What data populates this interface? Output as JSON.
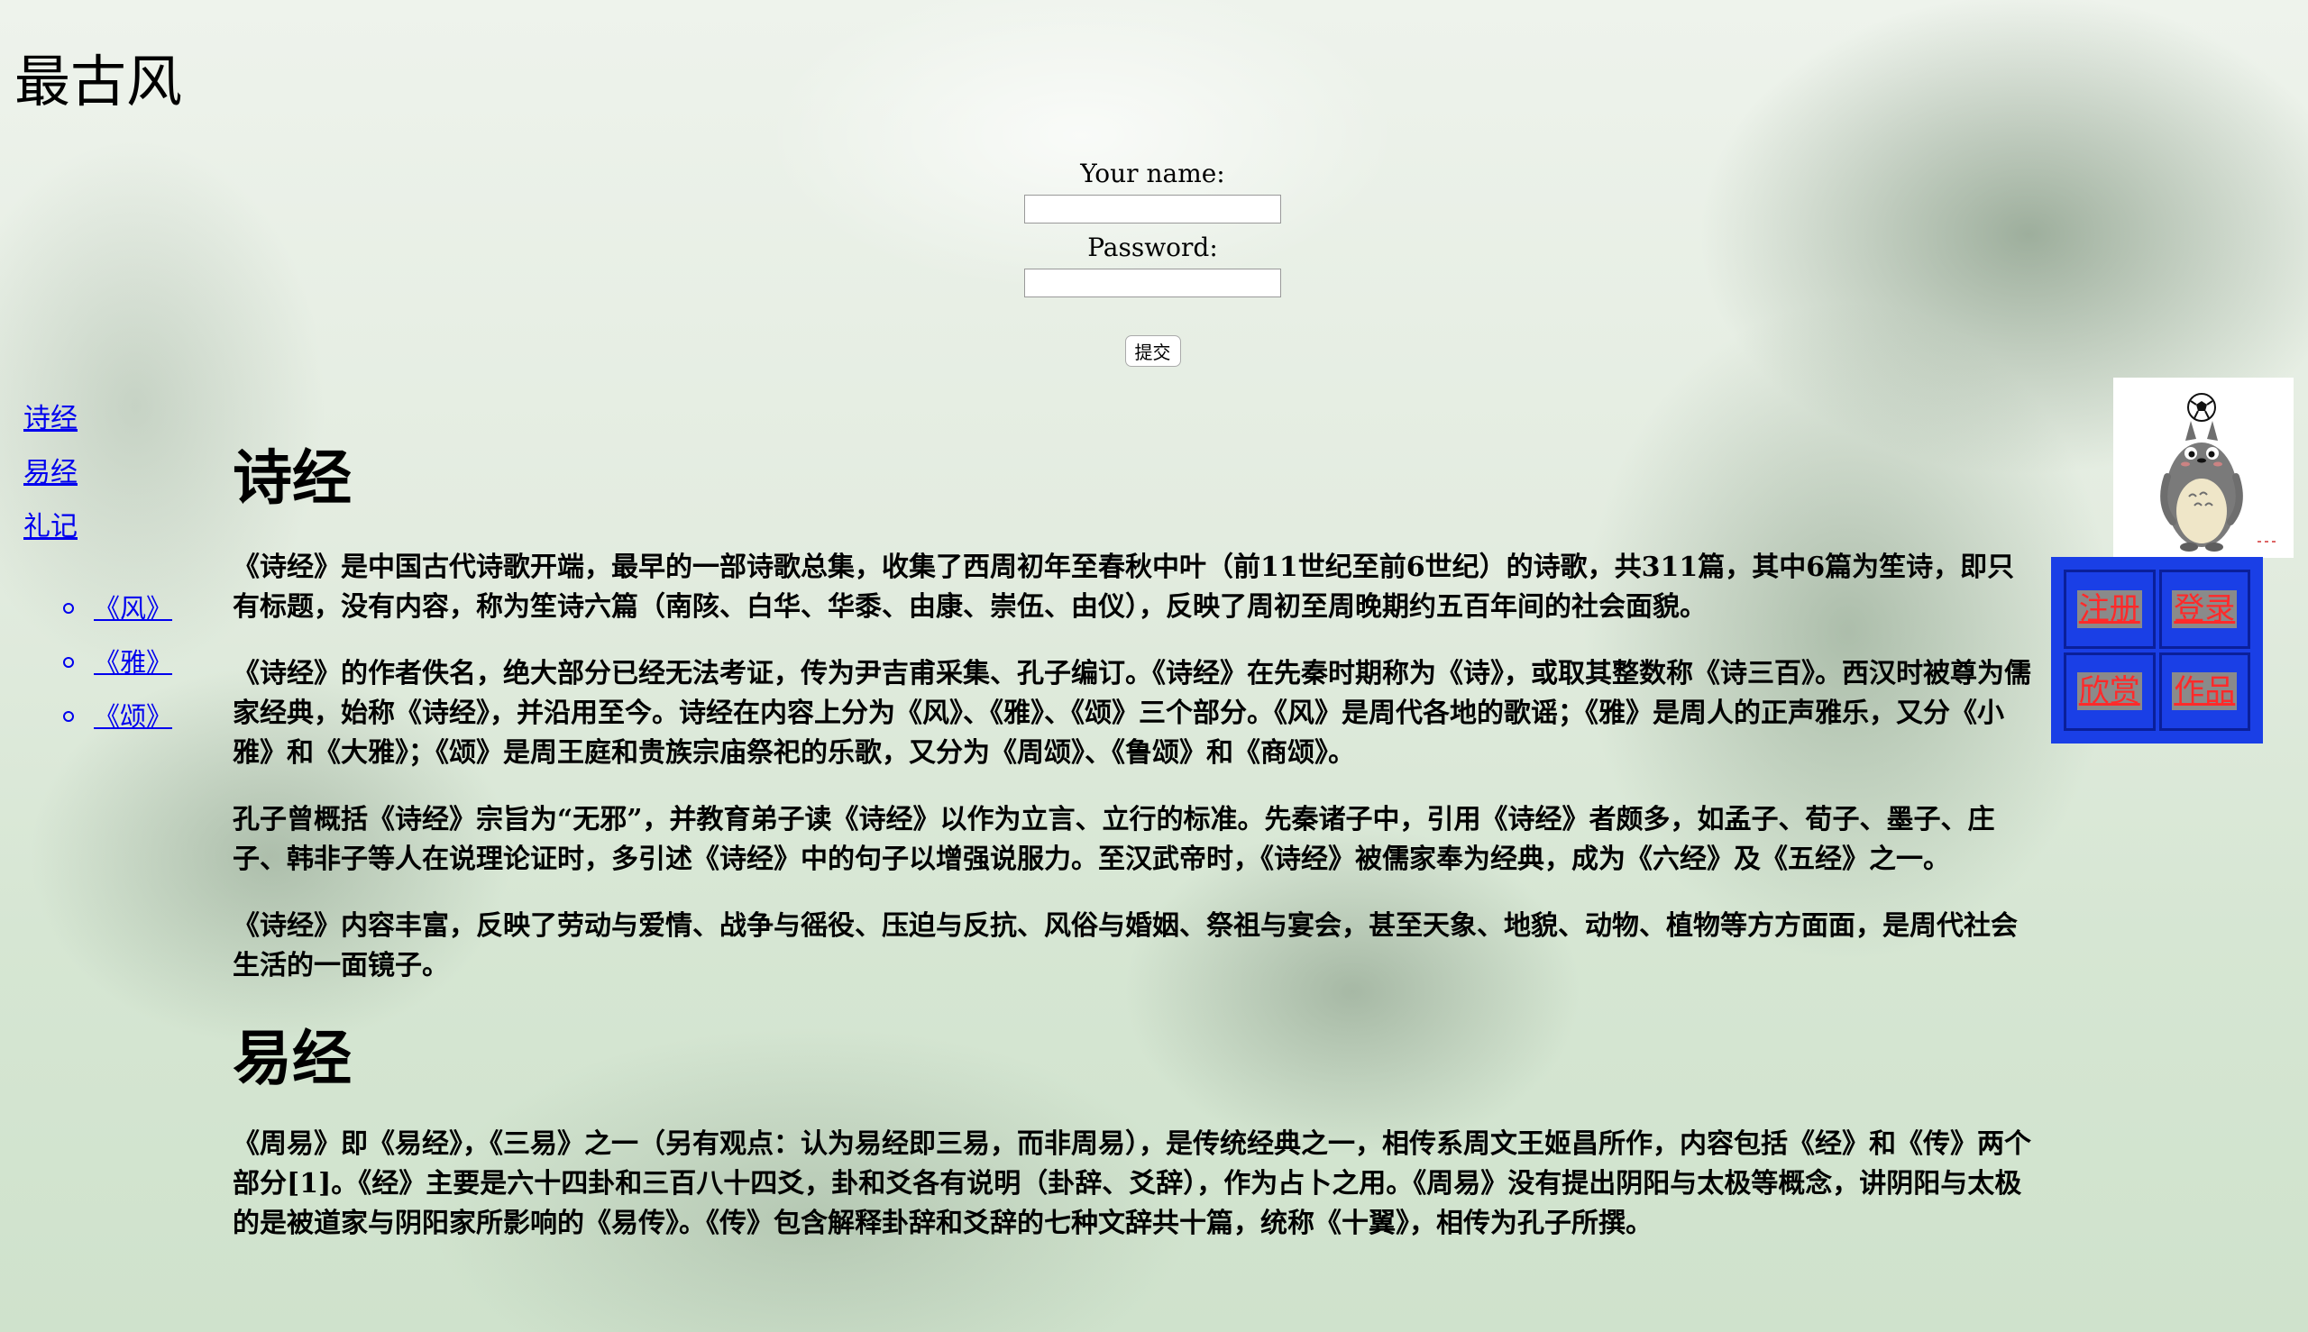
{
  "site": {
    "title": "最古风"
  },
  "login": {
    "name_label": "Your name:",
    "name_value": "",
    "password_label": "Password:",
    "password_value": "",
    "submit_label": "提交"
  },
  "side_nav": {
    "items": [
      {
        "label": "诗经"
      },
      {
        "label": "易经"
      },
      {
        "label": "礼记"
      }
    ],
    "sub_items": [
      {
        "label": "《风》"
      },
      {
        "label": "《雅》"
      },
      {
        "label": "《颂》"
      }
    ]
  },
  "main": {
    "section1": {
      "title": "诗经",
      "paragraphs": [
        "《诗经》是中国古代诗歌开端，最早的一部诗歌总集，收集了西周初年至春秋中叶（前11世纪至前6世纪）的诗歌，共311篇，其中6篇为笙诗，即只有标题，没有内容，称为笙诗六篇（南陔、白华、华黍、由康、崇伍、由仪），反映了周初至周晚期约五百年间的社会面貌。",
        "《诗经》的作者佚名，绝大部分已经无法考证，传为尹吉甫采集、孔子编订。《诗经》在先秦时期称为《诗》，或取其整数称《诗三百》。西汉时被尊为儒家经典，始称《诗经》，并沿用至今。诗经在内容上分为《风》、《雅》、《颂》三个部分。《风》是周代各地的歌谣；《雅》是周人的正声雅乐，又分《小雅》和《大雅》；《颂》是周王庭和贵族宗庙祭祀的乐歌，又分为《周颂》、《鲁颂》和《商颂》。",
        "孔子曾概括《诗经》宗旨为“无邪”，并教育弟子读《诗经》以作为立言、立行的标准。先秦诸子中，引用《诗经》者颇多，如孟子、荀子、墨子、庄子、韩非子等人在说理论证时，多引述《诗经》中的句子以增强说服力。至汉武帝时，《诗经》被儒家奉为经典，成为《六经》及《五经》之一。",
        "《诗经》内容丰富，反映了劳动与爱情、战争与徭役、压迫与反抗、风俗与婚姻、祭祖与宴会，甚至天象、地貌、动物、植物等方方面面，是周代社会生活的一面镜子。"
      ]
    },
    "section2": {
      "title": "易经",
      "paragraphs": [
        "《周易》即《易经》，《三易》之一（另有观点：认为易经即三易，而非周易），是传统经典之一，相传系周文王姬昌所作，内容包括《经》和《传》两个部分[1]。《经》主要是六十四卦和三百八十四爻，卦和爻各有说明（卦辞、爻辞），作为占卜之用。《周易》没有提出阴阳与太极等概念，讲阴阳与太极的是被道家与阴阳家所影响的《易传》。《传》包含解释卦辞和爻辞的七种文辞共十篇，统称《十翼》，相传为孔子所撰。"
      ]
    }
  },
  "nav_box": {
    "items": [
      {
        "label": "注册"
      },
      {
        "label": "登录"
      },
      {
        "label": "欣赏"
      },
      {
        "label": "作品"
      }
    ],
    "background_color": "#1a3fe6",
    "link_color": "#ff2a2a"
  },
  "mascot": {
    "icon": "totoro-with-soccer-ball-icon"
  }
}
